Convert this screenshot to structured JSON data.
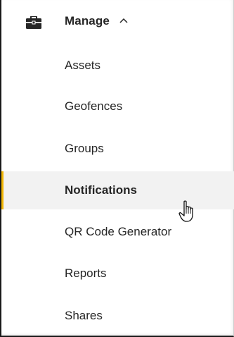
{
  "menu": {
    "header": {
      "icon": "briefcase-icon",
      "title": "Manage",
      "expanded_icon": "chevron-up-icon"
    },
    "items": [
      {
        "label": "Assets",
        "active": false
      },
      {
        "label": "Geofences",
        "active": false
      },
      {
        "label": "Groups",
        "active": false
      },
      {
        "label": "Notifications",
        "active": true
      },
      {
        "label": "QR Code Generator",
        "active": false
      },
      {
        "label": "Reports",
        "active": false
      },
      {
        "label": "Shares",
        "active": false
      }
    ]
  },
  "theme": {
    "accent": "#f2b705",
    "active_bg": "#f2f2f2",
    "text": "#262626"
  },
  "cursor": "hand-pointer-icon"
}
